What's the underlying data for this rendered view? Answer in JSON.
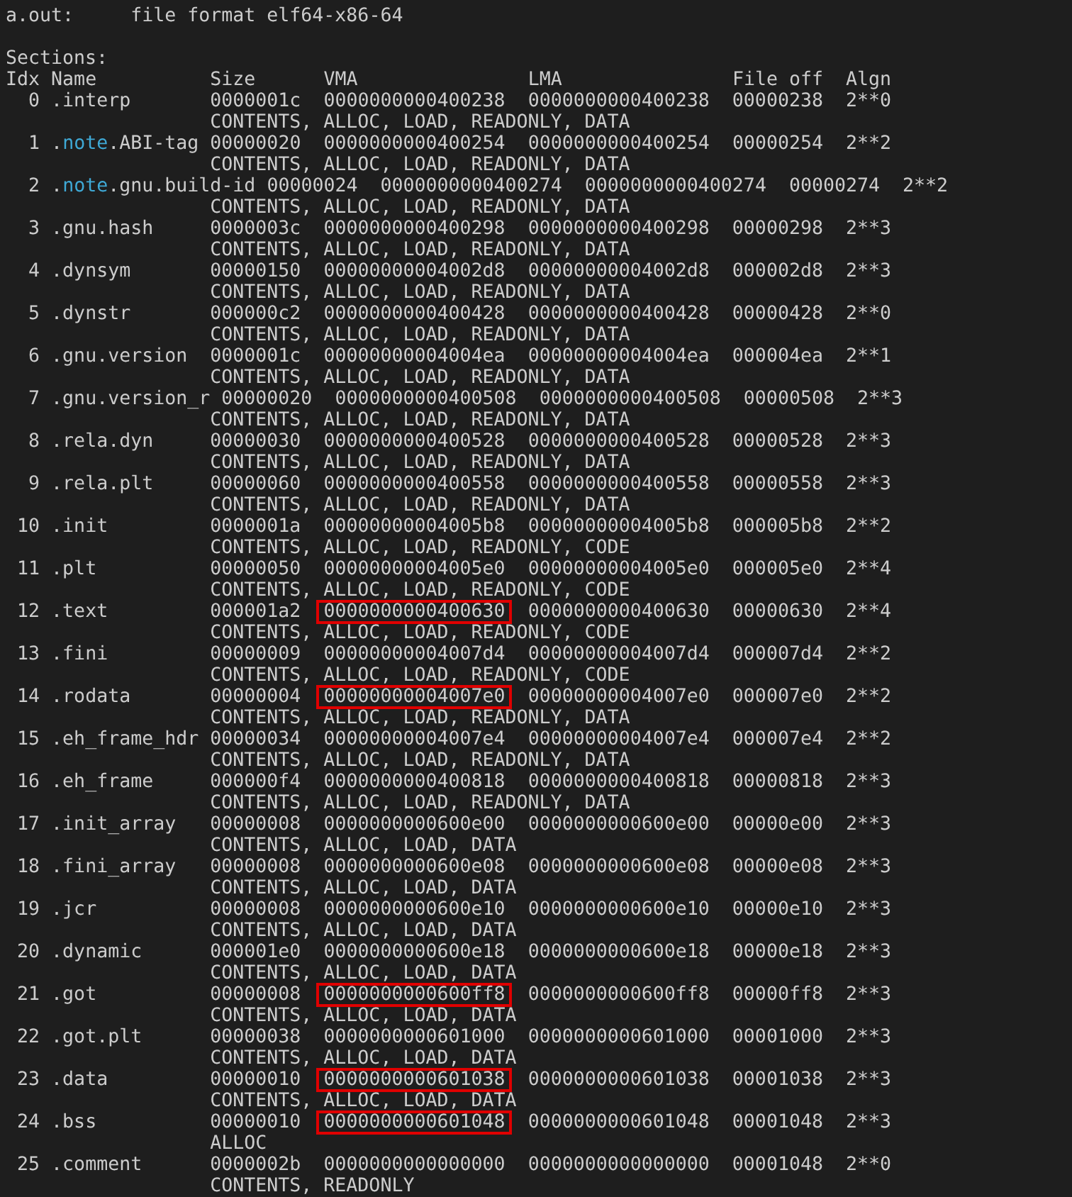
{
  "header": {
    "file": "a.out:",
    "format": "file format elf64-x86-64"
  },
  "title": "Sections:",
  "columns": [
    "Idx",
    "Name",
    "Size",
    "VMA",
    "LMA",
    "File off",
    "Algn"
  ],
  "sections": [
    {
      "idx": "0",
      "name": [
        {
          "text": ".interp",
          "highlight": false
        }
      ],
      "size": "0000001c",
      "vma": "0000000000400238",
      "lma": "0000000000400238",
      "file_off": "00000238",
      "algn": "2**0",
      "flags": "CONTENTS, ALLOC, LOAD, READONLY, DATA",
      "boxed": false
    },
    {
      "idx": "1",
      "name": [
        {
          "text": ".",
          "highlight": false
        },
        {
          "text": "note",
          "highlight": true
        },
        {
          "text": ".ABI-tag",
          "highlight": false
        }
      ],
      "size": "00000020",
      "vma": "0000000000400254",
      "lma": "0000000000400254",
      "file_off": "00000254",
      "algn": "2**2",
      "flags": "CONTENTS, ALLOC, LOAD, READONLY, DATA",
      "boxed": false
    },
    {
      "idx": "2",
      "name": [
        {
          "text": ".",
          "highlight": false
        },
        {
          "text": "note",
          "highlight": true
        },
        {
          "text": ".gnu.build-id",
          "highlight": false
        }
      ],
      "size": "00000024",
      "vma": "0000000000400274",
      "lma": "0000000000400274",
      "file_off": "00000274",
      "algn": "2**2",
      "flags": "CONTENTS, ALLOC, LOAD, READONLY, DATA",
      "boxed": false
    },
    {
      "idx": "3",
      "name": [
        {
          "text": ".gnu.hash",
          "highlight": false
        }
      ],
      "size": "0000003c",
      "vma": "0000000000400298",
      "lma": "0000000000400298",
      "file_off": "00000298",
      "algn": "2**3",
      "flags": "CONTENTS, ALLOC, LOAD, READONLY, DATA",
      "boxed": false
    },
    {
      "idx": "4",
      "name": [
        {
          "text": ".dynsym",
          "highlight": false
        }
      ],
      "size": "00000150",
      "vma": "00000000004002d8",
      "lma": "00000000004002d8",
      "file_off": "000002d8",
      "algn": "2**3",
      "flags": "CONTENTS, ALLOC, LOAD, READONLY, DATA",
      "boxed": false
    },
    {
      "idx": "5",
      "name": [
        {
          "text": ".dynstr",
          "highlight": false
        }
      ],
      "size": "000000c2",
      "vma": "0000000000400428",
      "lma": "0000000000400428",
      "file_off": "00000428",
      "algn": "2**0",
      "flags": "CONTENTS, ALLOC, LOAD, READONLY, DATA",
      "boxed": false
    },
    {
      "idx": "6",
      "name": [
        {
          "text": ".gnu.version",
          "highlight": false
        }
      ],
      "size": "0000001c",
      "vma": "00000000004004ea",
      "lma": "00000000004004ea",
      "file_off": "000004ea",
      "algn": "2**1",
      "flags": "CONTENTS, ALLOC, LOAD, READONLY, DATA",
      "boxed": false
    },
    {
      "idx": "7",
      "name": [
        {
          "text": ".gnu.version_r",
          "highlight": false
        }
      ],
      "size": "00000020",
      "vma": "0000000000400508",
      "lma": "0000000000400508",
      "file_off": "00000508",
      "algn": "2**3",
      "flags": "CONTENTS, ALLOC, LOAD, READONLY, DATA",
      "boxed": false
    },
    {
      "idx": "8",
      "name": [
        {
          "text": ".rela.dyn",
          "highlight": false
        }
      ],
      "size": "00000030",
      "vma": "0000000000400528",
      "lma": "0000000000400528",
      "file_off": "00000528",
      "algn": "2**3",
      "flags": "CONTENTS, ALLOC, LOAD, READONLY, DATA",
      "boxed": false
    },
    {
      "idx": "9",
      "name": [
        {
          "text": ".rela.plt",
          "highlight": false
        }
      ],
      "size": "00000060",
      "vma": "0000000000400558",
      "lma": "0000000000400558",
      "file_off": "00000558",
      "algn": "2**3",
      "flags": "CONTENTS, ALLOC, LOAD, READONLY, DATA",
      "boxed": false
    },
    {
      "idx": "10",
      "name": [
        {
          "text": ".init",
          "highlight": false
        }
      ],
      "size": "0000001a",
      "vma": "00000000004005b8",
      "lma": "00000000004005b8",
      "file_off": "000005b8",
      "algn": "2**2",
      "flags": "CONTENTS, ALLOC, LOAD, READONLY, CODE",
      "boxed": false
    },
    {
      "idx": "11",
      "name": [
        {
          "text": ".plt",
          "highlight": false
        }
      ],
      "size": "00000050",
      "vma": "00000000004005e0",
      "lma": "00000000004005e0",
      "file_off": "000005e0",
      "algn": "2**4",
      "flags": "CONTENTS, ALLOC, LOAD, READONLY, CODE",
      "boxed": false
    },
    {
      "idx": "12",
      "name": [
        {
          "text": ".text",
          "highlight": false
        }
      ],
      "size": "000001a2",
      "vma": "0000000000400630",
      "lma": "0000000000400630",
      "file_off": "00000630",
      "algn": "2**4",
      "flags": "CONTENTS, ALLOC, LOAD, READONLY, CODE",
      "boxed": true
    },
    {
      "idx": "13",
      "name": [
        {
          "text": ".fini",
          "highlight": false
        }
      ],
      "size": "00000009",
      "vma": "00000000004007d4",
      "lma": "00000000004007d4",
      "file_off": "000007d4",
      "algn": "2**2",
      "flags": "CONTENTS, ALLOC, LOAD, READONLY, CODE",
      "boxed": false
    },
    {
      "idx": "14",
      "name": [
        {
          "text": ".rodata",
          "highlight": false
        }
      ],
      "size": "00000004",
      "vma": "00000000004007e0",
      "lma": "00000000004007e0",
      "file_off": "000007e0",
      "algn": "2**2",
      "flags": "CONTENTS, ALLOC, LOAD, READONLY, DATA",
      "boxed": true
    },
    {
      "idx": "15",
      "name": [
        {
          "text": ".eh_frame_hdr",
          "highlight": false
        }
      ],
      "size": "00000034",
      "vma": "00000000004007e4",
      "lma": "00000000004007e4",
      "file_off": "000007e4",
      "algn": "2**2",
      "flags": "CONTENTS, ALLOC, LOAD, READONLY, DATA",
      "boxed": false
    },
    {
      "idx": "16",
      "name": [
        {
          "text": ".eh_frame",
          "highlight": false
        }
      ],
      "size": "000000f4",
      "vma": "0000000000400818",
      "lma": "0000000000400818",
      "file_off": "00000818",
      "algn": "2**3",
      "flags": "CONTENTS, ALLOC, LOAD, READONLY, DATA",
      "boxed": false
    },
    {
      "idx": "17",
      "name": [
        {
          "text": ".init_array",
          "highlight": false
        }
      ],
      "size": "00000008",
      "vma": "0000000000600e00",
      "lma": "0000000000600e00",
      "file_off": "00000e00",
      "algn": "2**3",
      "flags": "CONTENTS, ALLOC, LOAD, DATA",
      "boxed": false
    },
    {
      "idx": "18",
      "name": [
        {
          "text": ".fini_array",
          "highlight": false
        }
      ],
      "size": "00000008",
      "vma": "0000000000600e08",
      "lma": "0000000000600e08",
      "file_off": "00000e08",
      "algn": "2**3",
      "flags": "CONTENTS, ALLOC, LOAD, DATA",
      "boxed": false
    },
    {
      "idx": "19",
      "name": [
        {
          "text": ".jcr",
          "highlight": false
        }
      ],
      "size": "00000008",
      "vma": "0000000000600e10",
      "lma": "0000000000600e10",
      "file_off": "00000e10",
      "algn": "2**3",
      "flags": "CONTENTS, ALLOC, LOAD, DATA",
      "boxed": false
    },
    {
      "idx": "20",
      "name": [
        {
          "text": ".dynamic",
          "highlight": false
        }
      ],
      "size": "000001e0",
      "vma": "0000000000600e18",
      "lma": "0000000000600e18",
      "file_off": "00000e18",
      "algn": "2**3",
      "flags": "CONTENTS, ALLOC, LOAD, DATA",
      "boxed": false
    },
    {
      "idx": "21",
      "name": [
        {
          "text": ".got",
          "highlight": false
        }
      ],
      "size": "00000008",
      "vma": "0000000000600ff8",
      "lma": "0000000000600ff8",
      "file_off": "00000ff8",
      "algn": "2**3",
      "flags": "CONTENTS, ALLOC, LOAD, DATA",
      "boxed": true
    },
    {
      "idx": "22",
      "name": [
        {
          "text": ".got.plt",
          "highlight": false
        }
      ],
      "size": "00000038",
      "vma": "0000000000601000",
      "lma": "0000000000601000",
      "file_off": "00001000",
      "algn": "2**3",
      "flags": "CONTENTS, ALLOC, LOAD, DATA",
      "boxed": false
    },
    {
      "idx": "23",
      "name": [
        {
          "text": ".data",
          "highlight": false
        }
      ],
      "size": "00000010",
      "vma": "0000000000601038",
      "lma": "0000000000601038",
      "file_off": "00001038",
      "algn": "2**3",
      "flags": "CONTENTS, ALLOC, LOAD, DATA",
      "boxed": true
    },
    {
      "idx": "24",
      "name": [
        {
          "text": ".bss",
          "highlight": false
        }
      ],
      "size": "00000010",
      "vma": "0000000000601048",
      "lma": "0000000000601048",
      "file_off": "00001048",
      "algn": "2**3",
      "flags": "ALLOC",
      "boxed": true
    },
    {
      "idx": "25",
      "name": [
        {
          "text": ".comment",
          "highlight": false
        }
      ],
      "size": "0000002b",
      "vma": "0000000000000000",
      "lma": "0000000000000000",
      "file_off": "00001048",
      "algn": "2**0",
      "flags": "CONTENTS, READONLY",
      "boxed": false
    }
  ]
}
